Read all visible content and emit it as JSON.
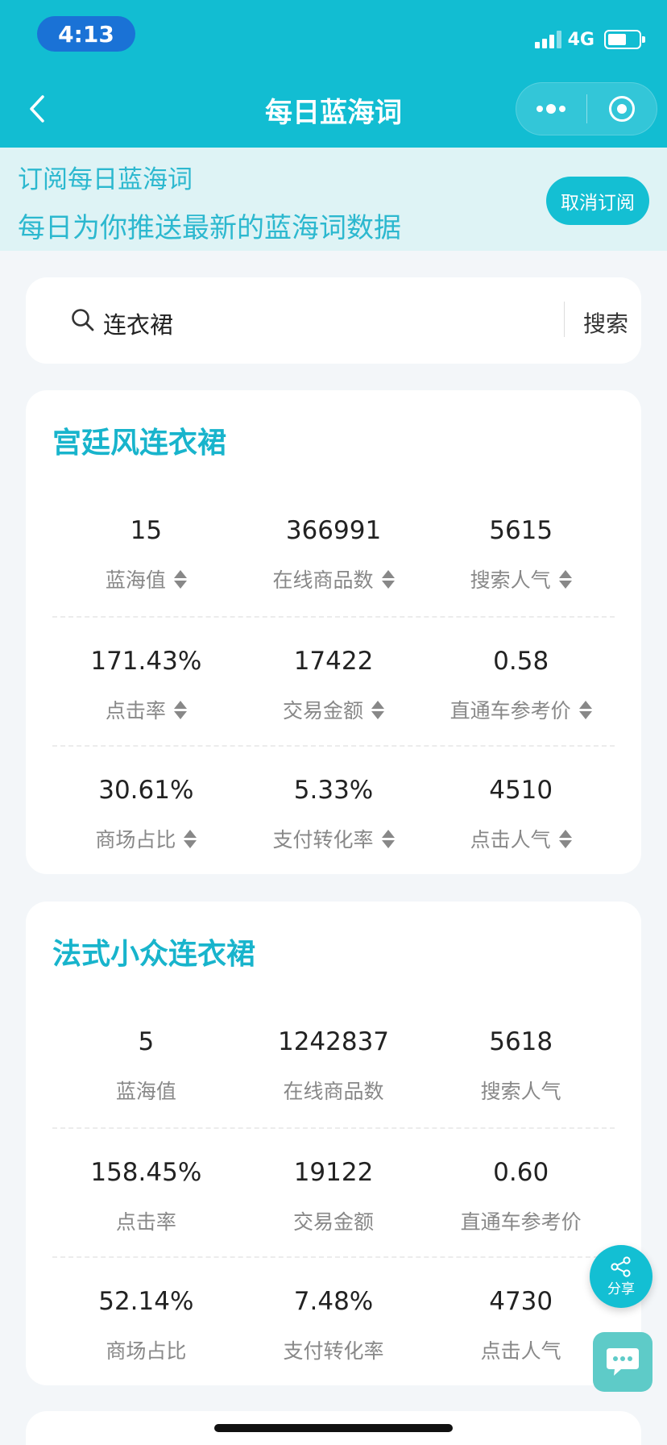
{
  "status_bar": {
    "time": "4:13",
    "network": "4G"
  },
  "nav": {
    "title": "每日蓝海词"
  },
  "banner": {
    "title": "订阅每日蓝海词",
    "subtitle": "每日为你推送最新的蓝海词数据",
    "unsubscribe_label": "取消订阅"
  },
  "search": {
    "value": "连衣裙",
    "button_label": "搜索"
  },
  "cards": [
    {
      "title": "宫廷风连衣裙",
      "rows": [
        [
          {
            "value": "15",
            "label": "蓝海值"
          },
          {
            "value": "366991",
            "label": "在线商品数"
          },
          {
            "value": "5615",
            "label": "搜索人气"
          }
        ],
        [
          {
            "value": "171.43%",
            "label": "点击率"
          },
          {
            "value": "17422",
            "label": "交易金额"
          },
          {
            "value": "0.58",
            "label": "直通车参考价"
          }
        ],
        [
          {
            "value": "30.61%",
            "label": "商场占比"
          },
          {
            "value": "5.33%",
            "label": "支付转化率"
          },
          {
            "value": "4510",
            "label": "点击人气"
          }
        ]
      ]
    },
    {
      "title": "法式小众连衣裙",
      "rows": [
        [
          {
            "value": "5",
            "label": "蓝海值"
          },
          {
            "value": "1242837",
            "label": "在线商品数"
          },
          {
            "value": "5618",
            "label": "搜索人气"
          }
        ],
        [
          {
            "value": "158.45%",
            "label": "点击率"
          },
          {
            "value": "19122",
            "label": "交易金额"
          },
          {
            "value": "0.60",
            "label": "直通车参考价"
          }
        ],
        [
          {
            "value": "52.14%",
            "label": "商场占比"
          },
          {
            "value": "7.48%",
            "label": "支付转化率"
          },
          {
            "value": "4730",
            "label": "点击人气"
          }
        ]
      ]
    }
  ],
  "share_fab": {
    "label": "分享"
  }
}
